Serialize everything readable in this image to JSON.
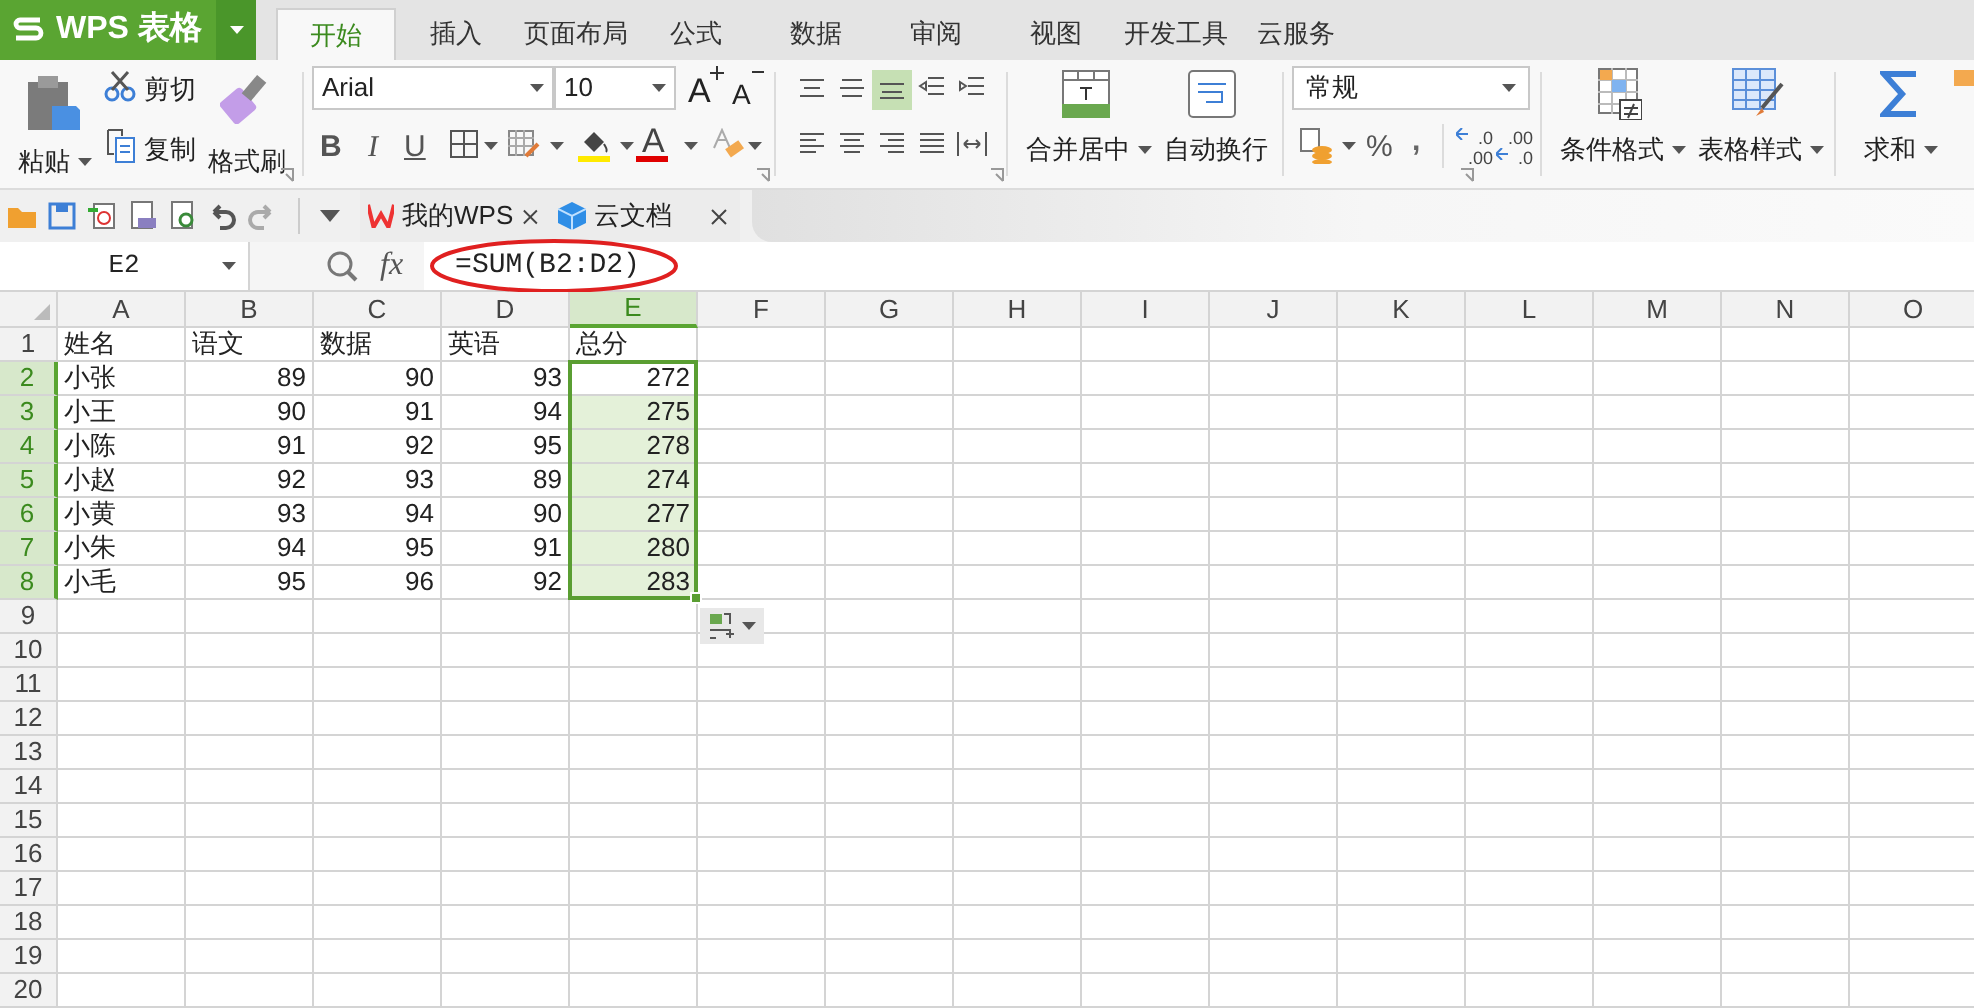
{
  "app_button": {
    "label": "WPS 表格"
  },
  "tabs": [
    {
      "label": "开始",
      "selected": true
    },
    {
      "label": "插入",
      "selected": false
    },
    {
      "label": "页面布局",
      "selected": false
    },
    {
      "label": "公式",
      "selected": false
    },
    {
      "label": "数据",
      "selected": false
    },
    {
      "label": "审阅",
      "selected": false
    },
    {
      "label": "视图",
      "selected": false
    },
    {
      "label": "开发工具",
      "selected": false
    },
    {
      "label": "云服务",
      "selected": false
    }
  ],
  "ribbon": {
    "paste": "粘贴",
    "cut": "剪切",
    "copy": "复制",
    "format_painter": "格式刷",
    "font_name": "Arial",
    "font_size": "10",
    "font_grow": "A",
    "font_shrink": "A",
    "bold": "B",
    "italic": "I",
    "underline": "U",
    "font_color": "A",
    "merge_center": "合并居中",
    "wrap_text": "自动换行",
    "number_format": "常规",
    "percent": "%",
    "comma": ",",
    "increase_decimal": [
      ".0",
      ".00"
    ],
    "decrease_decimal": [
      ".00",
      ".0"
    ],
    "conditional_format": "条件格式",
    "table_style": "表格样式",
    "sum": "求和"
  },
  "doc_tabs": [
    {
      "label": "我的WPS"
    },
    {
      "label": "云文档"
    }
  ],
  "formula_bar": {
    "name_box": "E2",
    "function_button": "fx",
    "formula": "=SUM(B2:D2)",
    "circled": true
  },
  "sheet": {
    "columns": [
      {
        "label": "A",
        "selected": false
      },
      {
        "label": "B",
        "selected": false
      },
      {
        "label": "C",
        "selected": false
      },
      {
        "label": "D",
        "selected": false
      },
      {
        "label": "E",
        "selected": true
      },
      {
        "label": "F",
        "selected": false
      },
      {
        "label": "G",
        "selected": false
      },
      {
        "label": "H",
        "selected": false
      },
      {
        "label": "I",
        "selected": false
      },
      {
        "label": "J",
        "selected": false
      },
      {
        "label": "K",
        "selected": false
      },
      {
        "label": "L",
        "selected": false
      },
      {
        "label": "M",
        "selected": false
      },
      {
        "label": "N",
        "selected": false
      },
      {
        "label": "O",
        "selected": false
      }
    ],
    "rows": [
      {
        "label": "1",
        "selected": false,
        "cells": [
          "姓名",
          "语文",
          "数据",
          "英语",
          "总分"
        ]
      },
      {
        "label": "2",
        "selected": true,
        "cells": [
          "小张",
          "89",
          "90",
          "93",
          "272"
        ]
      },
      {
        "label": "3",
        "selected": true,
        "cells": [
          "小王",
          "90",
          "91",
          "94",
          "275"
        ]
      },
      {
        "label": "4",
        "selected": true,
        "cells": [
          "小陈",
          "91",
          "92",
          "95",
          "278"
        ]
      },
      {
        "label": "5",
        "selected": true,
        "cells": [
          "小赵",
          "92",
          "93",
          "89",
          "274"
        ]
      },
      {
        "label": "6",
        "selected": true,
        "cells": [
          "小黄",
          "93",
          "94",
          "90",
          "277"
        ]
      },
      {
        "label": "7",
        "selected": true,
        "cells": [
          "小朱",
          "94",
          "95",
          "91",
          "280"
        ]
      },
      {
        "label": "8",
        "selected": true,
        "cells": [
          "小毛",
          "95",
          "96",
          "92",
          "283"
        ]
      },
      {
        "label": "9",
        "selected": false
      },
      {
        "label": "10",
        "selected": false
      },
      {
        "label": "11",
        "selected": false
      },
      {
        "label": "12",
        "selected": false
      },
      {
        "label": "13",
        "selected": false
      },
      {
        "label": "14",
        "selected": false
      },
      {
        "label": "15",
        "selected": false
      },
      {
        "label": "16",
        "selected": false
      },
      {
        "label": "17",
        "selected": false
      },
      {
        "label": "18",
        "selected": false
      },
      {
        "label": "19",
        "selected": false
      },
      {
        "label": "20",
        "selected": false
      }
    ]
  }
}
